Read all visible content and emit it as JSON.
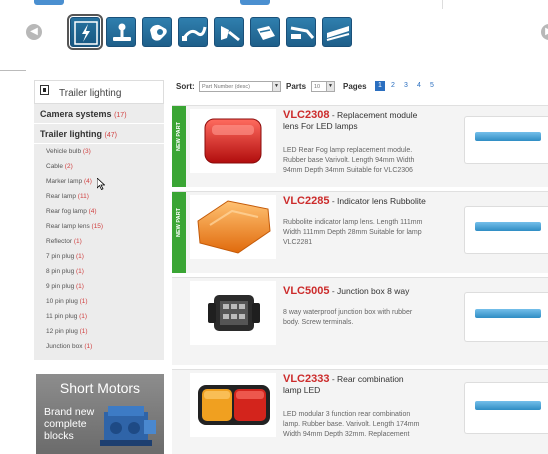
{
  "icon_bar": {
    "categories": [
      {
        "icon": "lightning-icon",
        "selected": true
      },
      {
        "icon": "tow-bar-icon",
        "selected": false
      },
      {
        "icon": "hand-icon",
        "selected": false
      },
      {
        "icon": "cable-icon",
        "selected": false
      },
      {
        "icon": "socket-icon",
        "selected": false
      },
      {
        "icon": "plug-icon",
        "selected": false
      },
      {
        "icon": "wiring-kit-icon",
        "selected": false
      },
      {
        "icon": "connector-icon",
        "selected": false
      }
    ]
  },
  "sidebar": {
    "heading": "Trailer lighting",
    "sections": [
      {
        "label": "Camera systems",
        "count": "(17)"
      },
      {
        "label": "Trailer lighting",
        "count": "(47)"
      }
    ],
    "items": [
      {
        "label": "Vehicle bulb",
        "count": "(3)"
      },
      {
        "label": "Cable",
        "count": "(2)"
      },
      {
        "label": "Marker lamp",
        "count": "(4)"
      },
      {
        "label": "Rear lamp",
        "count": "(11)"
      },
      {
        "label": "Rear fog lamp",
        "count": "(4)"
      },
      {
        "label": "Rear lamp lens",
        "count": "(15)"
      },
      {
        "label": "Reflector",
        "count": "(1)"
      },
      {
        "label": "7 pin plug",
        "count": "(1)"
      },
      {
        "label": "8 pin plug",
        "count": "(1)"
      },
      {
        "label": "9 pin plug",
        "count": "(1)"
      },
      {
        "label": "10 pin plug",
        "count": "(1)"
      },
      {
        "label": "11 pin plug",
        "count": "(1)"
      },
      {
        "label": "12 pin plug",
        "count": "(1)"
      },
      {
        "label": "Junction box",
        "count": "(1)"
      }
    ]
  },
  "banner": {
    "headline": "Short Motors",
    "line1": "Brand new",
    "line2": "complete",
    "line3": "blocks"
  },
  "toolbar": {
    "sort_label": "Sort:",
    "sort_value": "Part Number (desc)",
    "parts_label": "Parts",
    "parts_value": "10",
    "pages_label": "Pages",
    "pages": [
      "1",
      "2",
      "3",
      "4",
      "5"
    ]
  },
  "products": [
    {
      "new_tag": "NEW PART",
      "code": "VLC2308",
      "title": " - Replacement module",
      "title2": "lens For LED lamps",
      "desc1": "LED Rear Fog lamp replacement module.",
      "desc2": "Rubber base Varivolt. Length 94mm Width",
      "desc3": "94mm Depth 34mm Suitable for VLC2306"
    },
    {
      "new_tag": "NEW PART",
      "code": "VLC2285",
      "title": " - Indicator lens Rubbolite",
      "title2": "",
      "desc1": "Rubbolite indicator lamp lens. Length 111mm",
      "desc2": "Width 111mm Depth 28mm Suitable for lamp",
      "desc3": "VLC2281"
    },
    {
      "new_tag": "",
      "code": "VLC5005",
      "title": " - Junction box 8 way",
      "title2": "",
      "desc1": "8 way waterproof junction box with rubber",
      "desc2": "body. Screw terminals.",
      "desc3": ""
    },
    {
      "new_tag": "",
      "code": "VLC2333",
      "title": " - Rear combination",
      "title2": "lamp LED",
      "desc1": "LED modular 3 function rear combination",
      "desc2": "lamp. Rubber base. Varivolt. Length 174mm",
      "desc3": "Width 94mm Depth 32mm. Replacement"
    }
  ],
  "colors": {
    "accent_blue": "#2b6fc0",
    "new_part_green": "#3aa534",
    "code_red": "#cc2b2b"
  }
}
